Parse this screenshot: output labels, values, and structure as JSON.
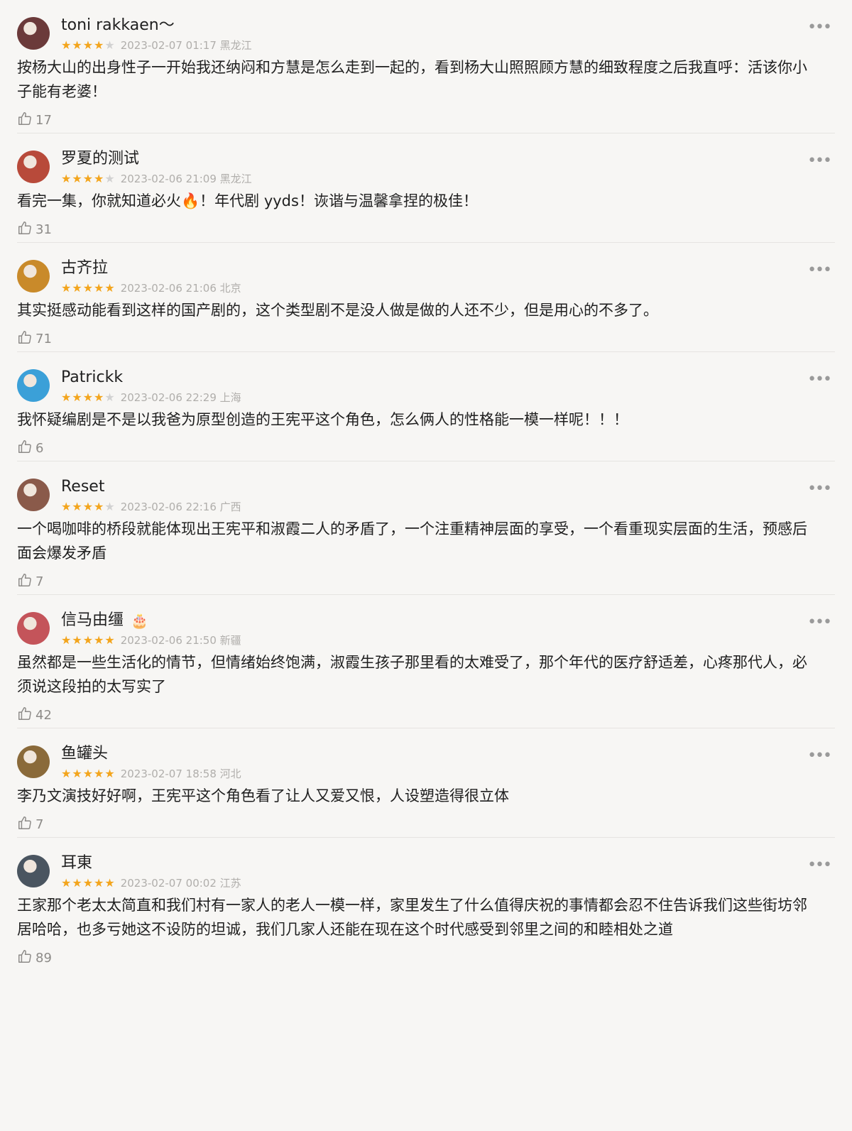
{
  "reviews": [
    {
      "user": "toni rakkaen～",
      "badge": "",
      "stars": 4,
      "meta": "2023-02-07 01:17 黑龙江",
      "text": "按杨大山的出身性子一开始我还纳闷和方慧是怎么走到一起的，看到杨大山照照顾方慧的细致程度之后我直呼：活该你小子能有老婆！",
      "likes": "17",
      "avatar_color": "#6b3a3a"
    },
    {
      "user": "罗夏的测试",
      "badge": "",
      "stars": 4,
      "meta": "2023-02-06 21:09 黑龙江",
      "text": "看完一集，你就知道必火🔥！年代剧 yyds！诙谐与温馨拿捏的极佳！",
      "likes": "31",
      "avatar_color": "#b84a3a"
    },
    {
      "user": "古齐拉",
      "badge": "",
      "stars": 5,
      "meta": "2023-02-06 21:06 北京",
      "text": "其实挺感动能看到这样的国产剧的，这个类型剧不是没人做是做的人还不少，但是用心的不多了。",
      "likes": "71",
      "avatar_color": "#c98a2a"
    },
    {
      "user": "Patrickk",
      "badge": "",
      "stars": 4,
      "meta": "2023-02-06 22:29 上海",
      "text": "我怀疑编剧是不是以我爸为原型创造的王宪平这个角色，怎么俩人的性格能一模一样呢！！！",
      "likes": "6",
      "avatar_color": "#3ba0d8"
    },
    {
      "user": "Reset",
      "badge": "",
      "stars": 4,
      "meta": "2023-02-06 22:16 广西",
      "text": "一个喝咖啡的桥段就能体现出王宪平和淑霞二人的矛盾了，一个注重精神层面的享受，一个看重现实层面的生活，预感后面会爆发矛盾",
      "likes": "7",
      "avatar_color": "#8a5a4a"
    },
    {
      "user": "信马由缰",
      "badge": "🎂",
      "stars": 5,
      "meta": "2023-02-06 21:50 新疆",
      "text": "虽然都是一些生活化的情节，但情绪始终饱满，淑霞生孩子那里看的太难受了，那个年代的医疗舒适差，心疼那代人，必须说这段拍的太写实了",
      "likes": "42",
      "avatar_color": "#c4545a"
    },
    {
      "user": "鱼罐头",
      "badge": "",
      "stars": 5,
      "meta": "2023-02-07 18:58 河北",
      "text": "李乃文演技好好啊，王宪平这个角色看了让人又爱又恨，人设塑造得很立体",
      "likes": "7",
      "avatar_color": "#8a6a3a"
    },
    {
      "user": "耳東",
      "badge": "",
      "stars": 5,
      "meta": "2023-02-07 00:02 江苏",
      "text": "王家那个老太太简直和我们村有一家人的老人一模一样，家里发生了什么值得庆祝的事情都会忍不住告诉我们这些街坊邻居哈哈，也多亏她这不设防的坦诚，我们几家人还能在现在这个时代感受到邻里之间的和睦相处之道",
      "likes": "89",
      "avatar_color": "#4a5560"
    }
  ]
}
